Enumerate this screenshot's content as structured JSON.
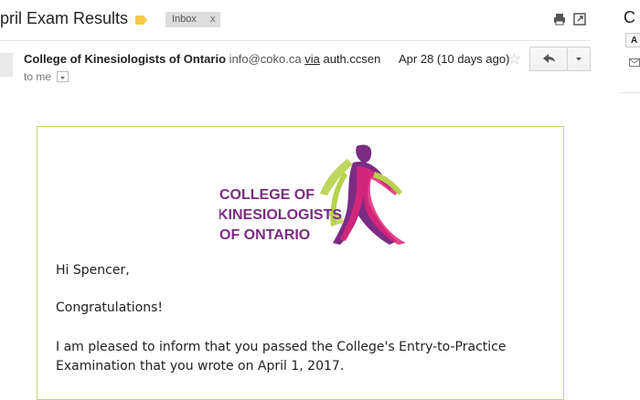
{
  "email": {
    "subject": "pril Exam Results",
    "label_chip": "Inbox",
    "label_chip_close": "x",
    "sender_name": "College of Kinesiologists of Ontario",
    "sender_email": "info@coko.ca",
    "via_label": "via",
    "via_domain": "auth.ccsen",
    "to_label": "to me",
    "date": "Apr 28 (10 days ago)"
  },
  "logo": {
    "line1": "COLLEGE OF",
    "line2": "KINESIOLOGISTS",
    "line3": "OF ONTARIO"
  },
  "body": {
    "greeting": "Hi Spencer,",
    "congrats": "Congratulations!",
    "para1_line1": "I am pleased to inform that you passed the College's Entry-to-Practice",
    "para1_line2": "Examination that you wrote on April 1, 2017."
  },
  "right_panel": {
    "partial_title": "C",
    "button_letter": "A"
  },
  "colors": {
    "label_tag": "#f7c948",
    "logo_purple": "#7b2c83",
    "logo_green": "#b7d24b",
    "logo_pink": "#e2267a",
    "box_border": "#c5d86d"
  },
  "icons": [
    "label-tag-icon",
    "print-icon",
    "new-window-icon",
    "star-icon",
    "reply-icon",
    "chevron-down-icon",
    "mail-icon"
  ]
}
